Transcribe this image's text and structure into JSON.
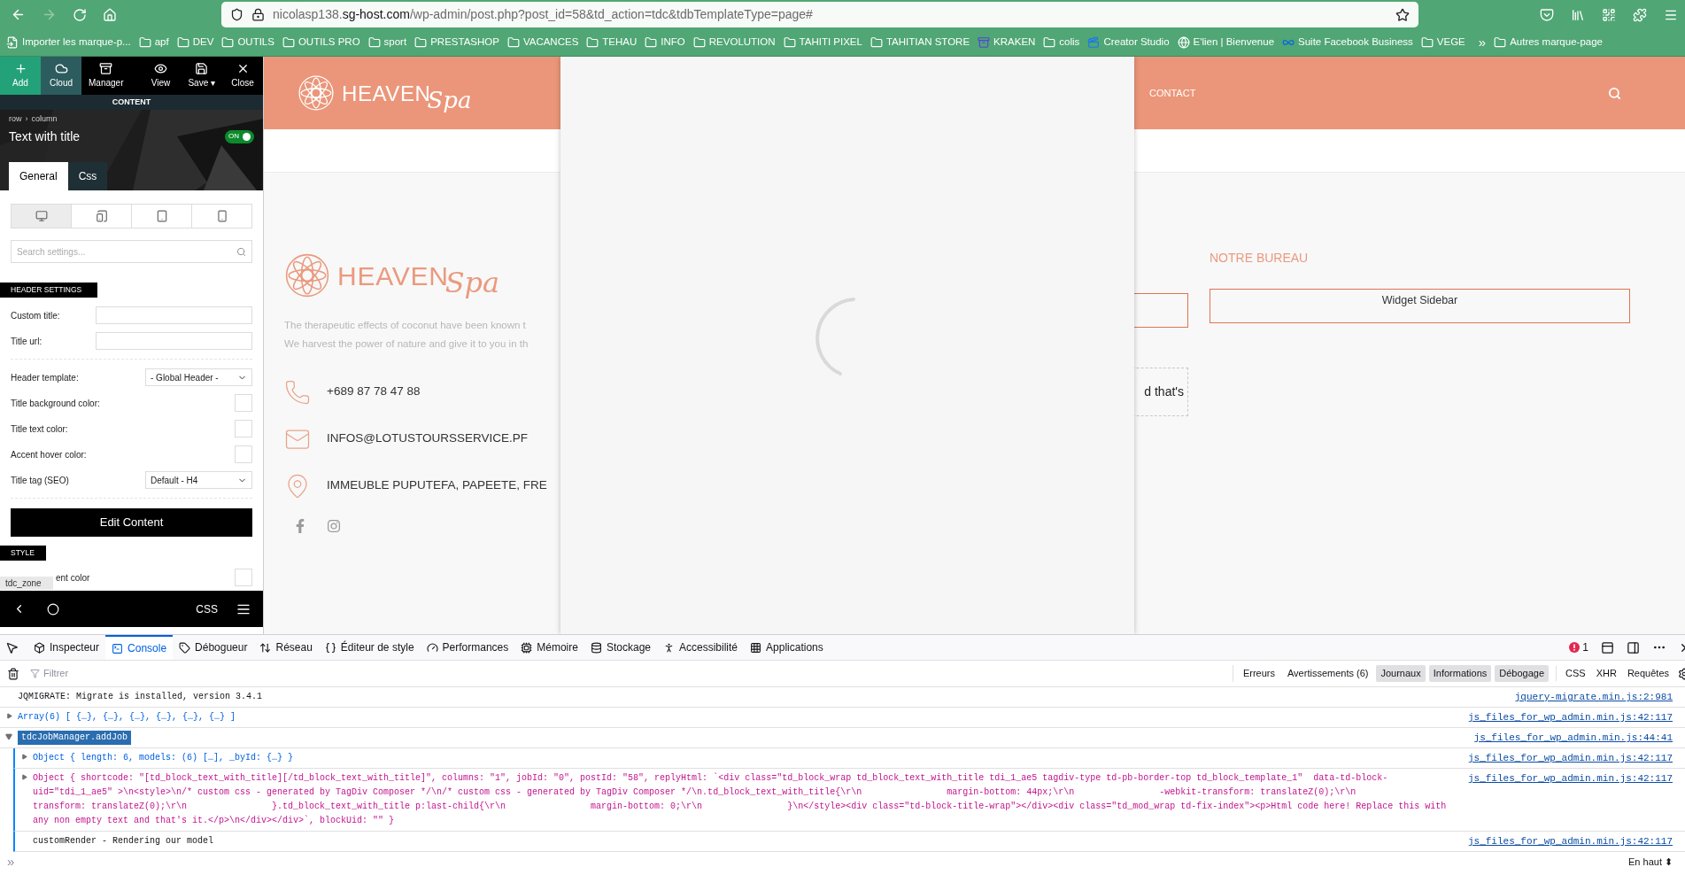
{
  "browser": {
    "url": {
      "subdomain": "nicolasp138.",
      "domain": "sg-host.com",
      "path": "/wp-admin/post.php?post_id=58&td_action=tdc&tdbTemplateType=page#"
    },
    "forward_disabled": true,
    "bookmarks": [
      {
        "kind": "import",
        "label": "Importer les marque-p..."
      },
      {
        "kind": "folder",
        "label": "apf"
      },
      {
        "kind": "folder",
        "label": "DEV"
      },
      {
        "kind": "folder",
        "label": "OUTILS"
      },
      {
        "kind": "folder",
        "label": "OUTILS PRO"
      },
      {
        "kind": "folder",
        "label": "sport"
      },
      {
        "kind": "folder",
        "label": "PRESTASHOP"
      },
      {
        "kind": "folder",
        "label": "VACANCES"
      },
      {
        "kind": "folder",
        "label": "TEHAU"
      },
      {
        "kind": "folder",
        "label": "INFO"
      },
      {
        "kind": "folder",
        "label": "REVOLUTION"
      },
      {
        "kind": "folder",
        "label": "TAHITI PIXEL"
      },
      {
        "kind": "folder",
        "label": "TAHITIAN STORE"
      },
      {
        "kind": "kraken",
        "label": "KRAKEN"
      },
      {
        "kind": "folder",
        "label": "colis"
      },
      {
        "kind": "video",
        "label": "Creator Studio"
      },
      {
        "kind": "globe",
        "label": "E'lien | Bienvenue"
      },
      {
        "kind": "meta",
        "label": "Suite Facebook Business"
      },
      {
        "kind": "folder",
        "label": "VEGE"
      }
    ],
    "more": "»",
    "other_bookmarks": "Autres marque-page"
  },
  "editor": {
    "toolbar": [
      {
        "kind": "add",
        "label": "Add"
      },
      {
        "kind": "cloud",
        "label": "Cloud"
      },
      {
        "kind": "manager",
        "label": "Manager"
      },
      {
        "kind": "view",
        "label": "View"
      },
      {
        "kind": "save",
        "label": "Save ▾"
      },
      {
        "kind": "close",
        "label": "Close"
      }
    ],
    "section": "CONTENT",
    "breadcrumb": [
      "row",
      "column"
    ],
    "breadcrumb_separator": "›",
    "element_title": "Text with title",
    "toggle": {
      "label": "ON",
      "on": true
    },
    "tabs": [
      {
        "label": "General",
        "selected": true
      },
      {
        "label": "Css",
        "selected": false
      }
    ],
    "devices": [
      {
        "kind": "desktop",
        "selected": true
      },
      {
        "kind": "landscape",
        "selected": false
      },
      {
        "kind": "tablet",
        "selected": false
      },
      {
        "kind": "phone",
        "selected": false
      }
    ],
    "search_placeholder": "Search settings...",
    "header_settings": {
      "title": "HEADER SETTINGS",
      "fields": [
        {
          "kind": "text",
          "label": "Custom title:"
        },
        {
          "kind": "text",
          "label": "Title url:"
        },
        {
          "kind": "divider"
        },
        {
          "kind": "select",
          "label": "Header template:",
          "value": "- Global Header -"
        },
        {
          "kind": "color",
          "label": "Title background color:"
        },
        {
          "kind": "color",
          "label": "Title text color:"
        },
        {
          "kind": "color",
          "label": "Accent hover color:"
        },
        {
          "kind": "select",
          "label": "Title tag (SEO)",
          "value": "Default - H4"
        },
        {
          "kind": "divider"
        }
      ]
    },
    "edit_button": "Edit Content",
    "style_title": "STYLE",
    "style_row": {
      "label": "ent color"
    },
    "tooltip": "tdc_zone",
    "bottom_bar": {
      "css": "CSS"
    }
  },
  "page": {
    "logo": {
      "word": "HEAVEN",
      "script": "Spa"
    },
    "nav": [
      "CONTACT"
    ],
    "footer": {
      "logo": {
        "word": "HEAVEN",
        "script": "Spa"
      },
      "description": [
        "The therapeutic effects of coconut have been known t",
        "We harvest the power of nature and give it to you in th"
      ],
      "contacts": [
        {
          "kind": "phone",
          "text": "+689 87 78 47 88"
        },
        {
          "kind": "mail",
          "text": "INFOS@LOTUSTOURSSERVICE.PF"
        },
        {
          "kind": "pin",
          "text": "IMMEUBLE PUPUTEFA, PAPEETE, FRE"
        }
      ],
      "social": [
        {
          "kind": "facebook"
        },
        {
          "kind": "instagram"
        }
      ],
      "snippet": "d that's",
      "widget_title": "NOTRE BUREAU",
      "widget": "Widget Sidebar"
    }
  },
  "devtools": {
    "tabs": [
      {
        "kind": "inspector",
        "label": "Inspecteur",
        "selected": false
      },
      {
        "kind": "console",
        "label": "Console",
        "selected": true
      },
      {
        "kind": "debugger",
        "label": "Débogueur",
        "selected": false
      },
      {
        "kind": "network",
        "label": "Réseau",
        "selected": false
      },
      {
        "kind": "style",
        "label": "Éditeur de style",
        "selected": false
      },
      {
        "kind": "performance",
        "label": "Performances",
        "selected": false
      },
      {
        "kind": "memory",
        "label": "Mémoire",
        "selected": false
      },
      {
        "kind": "storage",
        "label": "Stockage",
        "selected": false
      },
      {
        "kind": "accessibility",
        "label": "Accessibilité",
        "selected": false
      },
      {
        "kind": "applications",
        "label": "Applications",
        "selected": false
      }
    ],
    "error_count": "1",
    "filter_placeholder": "Filtrer",
    "filters": [
      {
        "label": "Erreurs",
        "selected": false
      },
      {
        "label": "Avertissements (6)",
        "selected": false
      },
      {
        "label": "Journaux",
        "selected": true
      },
      {
        "label": "Informations",
        "selected": true
      },
      {
        "label": "Débogage",
        "selected": true
      }
    ],
    "types": [
      "CSS",
      "XHR",
      "Requêtes"
    ],
    "messages": [
      {
        "kind": "log",
        "lines": [
          "JQMIGRATE: Migrate is installed, version 3.4.1"
        ],
        "source": "jquery-migrate.min.js:2:981"
      },
      {
        "kind": "object",
        "expanded": false,
        "lines": [
          "Array(6) [ {…}, {…}, {…}, {…}, {…}, {…} ]"
        ],
        "source": "js_files_for_wp_admin.min.js:42:117"
      },
      {
        "kind": "group",
        "expanded": true,
        "lines": [
          "tdcJobManager.addJob"
        ],
        "source": "js_files_for_wp_admin.min.js:44:41",
        "children": [
          {
            "kind": "object",
            "expanded": false,
            "lines": [
              "Object { length: 6, models: (6) […], _byId: {…} }"
            ],
            "source": "js_files_for_wp_admin.min.js:42:117"
          },
          {
            "kind": "string",
            "expanded": false,
            "lines": [
              "Object { shortcode: \"[td_block_text_with_title][/td_block_text_with_title]\", columns: \"1\", jobId: \"0\", postId: \"58\", replyHtml: `<div class=\"td_block_wrap td_block_text_with_title tdi_1_ae5 tagdiv-type td-pb-border-top td_block_template_1\"  data-td-block-",
              "uid=\"tdi_1_ae5\" >\\n<style>\\n/* custom css - generated by TagDiv Composer */\\n/* custom css - generated by TagDiv Composer */\\n.td_block_text_with_title{\\r\\n                margin-bottom: 44px;\\r\\n                -webkit-transform: translateZ(0);\\r\\n",
              "transform: translateZ(0);\\r\\n                }.td_block_text_with_title p:last-child{\\r\\n                margin-bottom: 0;\\r\\n                }\\n</style><div class=\"td-block-title-wrap\"></div><div class=\"td_mod_wrap td-fix-index\"><p>Html code here! Replace this with",
              "any non empty text and that's it.</p>\\n</div></div>`, blockUid: \"\" }"
            ],
            "source": "js_files_for_wp_admin.min.js:42:117"
          },
          {
            "kind": "log",
            "lines": [
              "customRender - Rendering our model"
            ],
            "source": "js_files_for_wp_admin.min.js:42:117"
          }
        ]
      }
    ],
    "prompt": "»",
    "position": "En haut ⬍"
  }
}
